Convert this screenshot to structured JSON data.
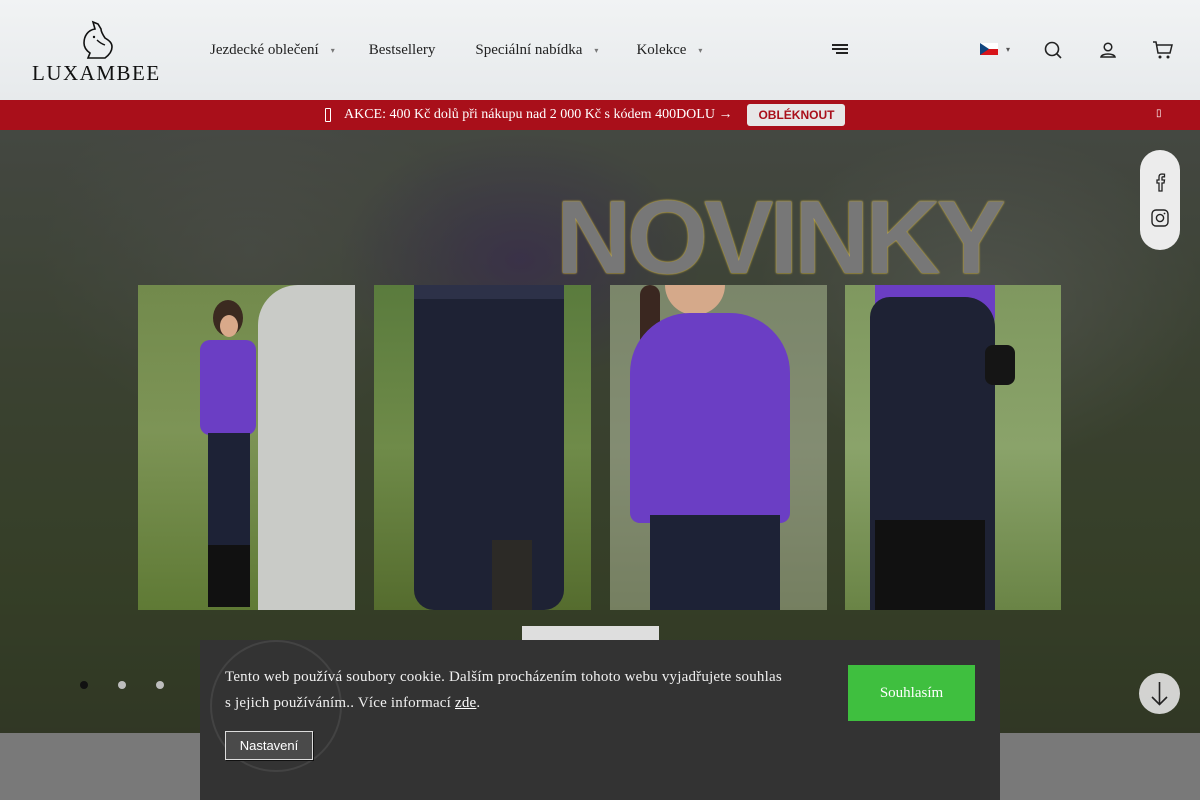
{
  "header": {
    "logo_text": "LUXAMBEE",
    "nav": [
      {
        "label": "Jezdecké oblečení",
        "has_dropdown": true
      },
      {
        "label": "Bestsellery",
        "has_dropdown": false
      },
      {
        "label": "Speciální nabídka",
        "has_dropdown": true
      },
      {
        "label": "Kolekce",
        "has_dropdown": true
      }
    ],
    "menu_icon": "hamburger-icon",
    "language_flag": "cz-flag",
    "icons": [
      "search-icon",
      "user-icon",
      "cart-icon"
    ]
  },
  "promo": {
    "text": "AKCE: 400 Kč dolů při nákupu nad 2 000 Kč s kódem 400DOLU →",
    "button_label": "OBLÉKNOUT",
    "icon": "ticket-icon",
    "close_icon": "close-icon"
  },
  "hero": {
    "title": "NOVINKY",
    "slide_count": 3,
    "active_slide": 1,
    "social_icons": [
      "facebook-icon",
      "instagram-icon"
    ],
    "scroll_icon": "arrow-down-icon"
  },
  "cookie": {
    "text_before_link": "Tento web používá soubory cookie. Dalším procházením tohoto webu vyjadřujete souhlas s jejich používáním.. Více informací ",
    "link_text": "zde",
    "text_after_link": ".",
    "settings_label": "Nastavení",
    "accept_label": "Souhlasím"
  },
  "colors": {
    "promo_bg": "#a90f1a",
    "accept_green": "#3fbf3f",
    "cookie_bg": "#333333"
  }
}
